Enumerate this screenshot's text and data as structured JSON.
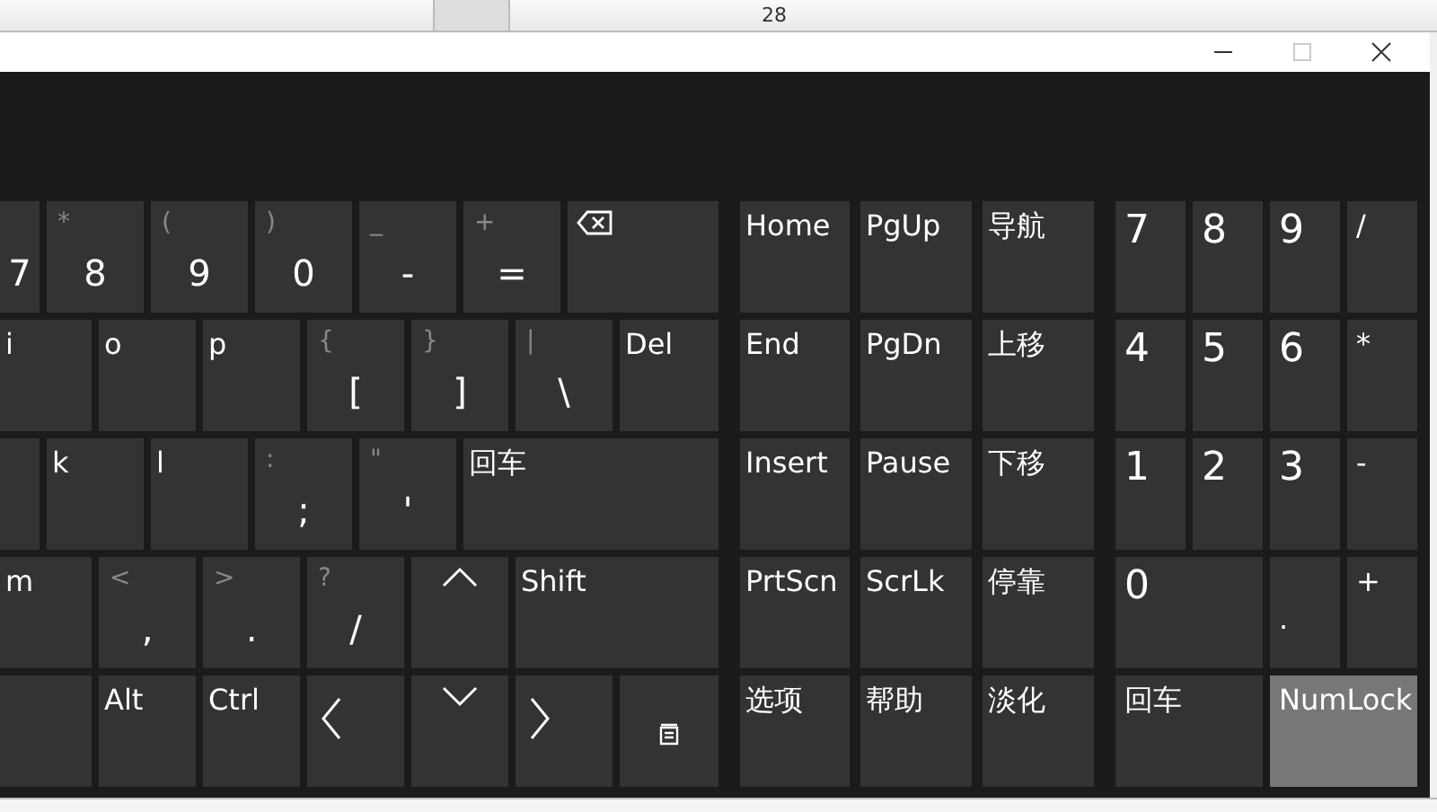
{
  "document": {
    "text": "28"
  },
  "keyboard": {
    "main_rows": [
      [
        {
          "kind": "char",
          "label": "7",
          "on": false
        },
        {
          "kind": "char",
          "shift": "*",
          "label": "8",
          "on": false
        },
        {
          "kind": "char",
          "shift": "(",
          "label": "9",
          "on": false
        },
        {
          "kind": "char",
          "shift": ")",
          "label": "0",
          "on": false
        },
        {
          "kind": "char",
          "shift": "_",
          "label": "-",
          "on": false
        },
        {
          "kind": "char",
          "shift": "+",
          "label": "=",
          "on": false
        },
        {
          "kind": "backspace",
          "on": false
        }
      ],
      [
        {
          "kind": "word",
          "label": "i",
          "on": false
        },
        {
          "kind": "word",
          "label": "o",
          "on": false
        },
        {
          "kind": "word",
          "label": "p",
          "on": false
        },
        {
          "kind": "char",
          "shift": "{",
          "label": "[",
          "on": false
        },
        {
          "kind": "char",
          "shift": "}",
          "label": "]",
          "on": false
        },
        {
          "kind": "char",
          "shift": "|",
          "label": "\\",
          "on": false
        },
        {
          "kind": "word",
          "label": "Del",
          "on": false
        }
      ],
      [
        {
          "kind": "blank",
          "on": false
        },
        {
          "kind": "word",
          "label": "k",
          "on": false
        },
        {
          "kind": "word",
          "label": "l",
          "on": false
        },
        {
          "kind": "char",
          "shift": ":",
          "label": ";",
          "on": false
        },
        {
          "kind": "char",
          "shift": "\"",
          "label": "'",
          "on": false
        },
        {
          "kind": "word",
          "label": "回车",
          "on": false
        }
      ],
      [
        {
          "kind": "word",
          "label": "m",
          "on": false
        },
        {
          "kind": "char",
          "shift": "<",
          "label": ",",
          "on": false
        },
        {
          "kind": "char",
          "shift": ">",
          "label": ".",
          "on": false
        },
        {
          "kind": "char",
          "shift": "?",
          "label": "/",
          "on": false
        },
        {
          "kind": "up",
          "on": false
        },
        {
          "kind": "word",
          "label": "Shift",
          "on": false
        }
      ],
      [
        {
          "kind": "blank",
          "on": false
        },
        {
          "kind": "word",
          "label": "Alt",
          "on": false
        },
        {
          "kind": "word",
          "label": "Ctrl",
          "on": false
        },
        {
          "kind": "left",
          "on": false
        },
        {
          "kind": "down",
          "on": false
        },
        {
          "kind": "right",
          "on": false
        },
        {
          "kind": "menu",
          "on": false
        }
      ]
    ],
    "nav_keys": [
      {
        "label": "Home",
        "on": false
      },
      {
        "label": "PgUp",
        "on": false
      },
      {
        "label": "导航",
        "on": false
      },
      {
        "label": "End",
        "on": false
      },
      {
        "label": "PgDn",
        "on": false
      },
      {
        "label": "上移",
        "on": false
      },
      {
        "label": "Insert",
        "on": false
      },
      {
        "label": "Pause",
        "on": false
      },
      {
        "label": "下移",
        "on": false
      },
      {
        "label": "PrtScn",
        "on": false
      },
      {
        "label": "ScrLk",
        "on": false
      },
      {
        "label": "停靠",
        "on": false
      },
      {
        "label": "选项",
        "on": false
      },
      {
        "label": "帮助",
        "on": false
      },
      {
        "label": "淡化",
        "on": false
      }
    ],
    "numpad_keys": [
      {
        "kind": "num",
        "label": "7",
        "on": false
      },
      {
        "kind": "num",
        "label": "8",
        "on": false
      },
      {
        "kind": "num",
        "label": "9",
        "on": false
      },
      {
        "kind": "word",
        "label": "/",
        "on": false
      },
      {
        "kind": "num",
        "label": "4",
        "on": false
      },
      {
        "kind": "num",
        "label": "5",
        "on": false
      },
      {
        "kind": "num",
        "label": "6",
        "on": false
      },
      {
        "kind": "word",
        "label": "*",
        "on": false
      },
      {
        "kind": "num",
        "label": "1",
        "on": false
      },
      {
        "kind": "num",
        "label": "2",
        "on": false
      },
      {
        "kind": "num",
        "label": "3",
        "on": false
      },
      {
        "kind": "word",
        "label": "-",
        "on": false
      },
      {
        "kind": "wide-num",
        "label": "0",
        "on": false
      },
      {
        "kind": "low",
        "label": ".",
        "on": false
      },
      {
        "kind": "word",
        "label": "+",
        "on": false
      },
      {
        "kind": "wide",
        "label": "回车",
        "on": false
      },
      {
        "kind": "wide",
        "label": "NumLock",
        "on": true
      }
    ]
  }
}
